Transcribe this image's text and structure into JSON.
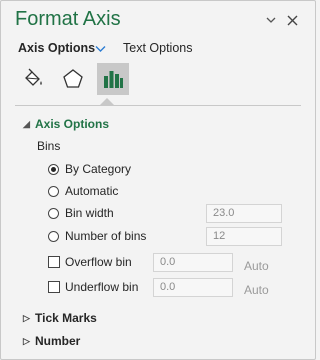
{
  "pane": {
    "title": "Format Axis",
    "dropdown_icon": "chevron-down-icon",
    "close_icon": "close-icon"
  },
  "subtabs": {
    "axis_options": "Axis Options",
    "text_options": "Text Options"
  },
  "icon_tabs": [
    {
      "name": "fill-line-icon"
    },
    {
      "name": "effects-pentagon-icon"
    },
    {
      "name": "bar-chart-icon",
      "selected": true
    }
  ],
  "sections": {
    "axis_options": "Axis Options",
    "tick_marks": "Tick Marks",
    "number": "Number"
  },
  "bins": {
    "label": "Bins",
    "by_category": "By Category",
    "automatic": "Automatic",
    "bin_width_label": "Bin width",
    "bin_width_value": "23.0",
    "number_of_bins_label": "Number of bins",
    "number_of_bins_value": "12",
    "overflow_label": "Overflow bin",
    "overflow_value": "0.0",
    "overflow_auto": "Auto",
    "underflow_label": "Underflow bin",
    "underflow_value": "0.0",
    "underflow_auto": "Auto",
    "selected": "By Category"
  },
  "colors": {
    "accent": "#217346",
    "selected_tab_bg": "#c8c8c8",
    "panel_bg": "#f3f3f3"
  }
}
